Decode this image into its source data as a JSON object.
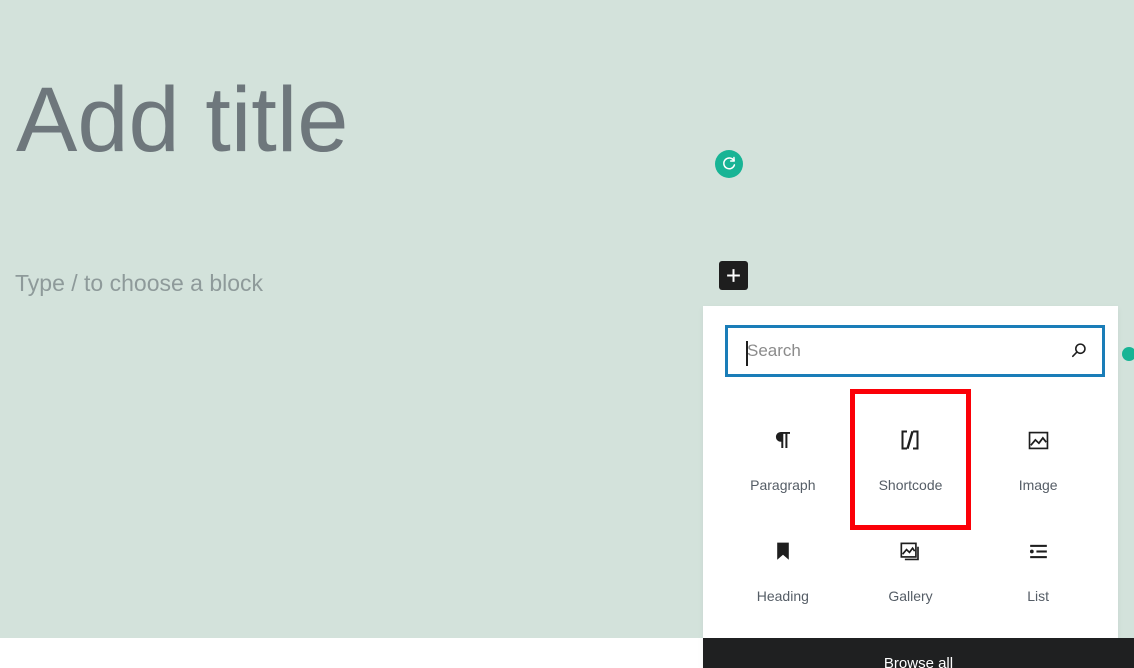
{
  "editor": {
    "title_placeholder": "Add title",
    "block_placeholder": "Type / to choose a block",
    "canvas_color": "#d3e2db",
    "title_color": "#6e777c",
    "placeholder_color": "#8e9a9a"
  },
  "toolbar": {
    "redo_badge": {
      "icon": "redo-icon",
      "color": "#18b495"
    },
    "add_block_button": {
      "icon": "plus-icon",
      "label": "Add block",
      "color": "#1e1e1e"
    }
  },
  "inserter": {
    "search": {
      "value": "",
      "placeholder": "Search",
      "icon": "search-icon",
      "focused": true,
      "focus_color": "#1a7db8"
    },
    "blocks": [
      {
        "label": "Paragraph",
        "icon": "pilcrow-icon",
        "highlighted": false
      },
      {
        "label": "Shortcode",
        "icon": "shortcode-icon",
        "highlighted": true
      },
      {
        "label": "Image",
        "icon": "image-icon",
        "highlighted": false
      },
      {
        "label": "Heading",
        "icon": "heading-bookmark-icon",
        "highlighted": false
      },
      {
        "label": "Gallery",
        "icon": "gallery-icon",
        "highlighted": false
      },
      {
        "label": "List",
        "icon": "list-icon",
        "highlighted": false
      }
    ],
    "highlight_color": "#fb0007",
    "browse_all_label": "Browse all"
  },
  "status_dot": {
    "name": "status-dot",
    "color": "#18b495"
  }
}
